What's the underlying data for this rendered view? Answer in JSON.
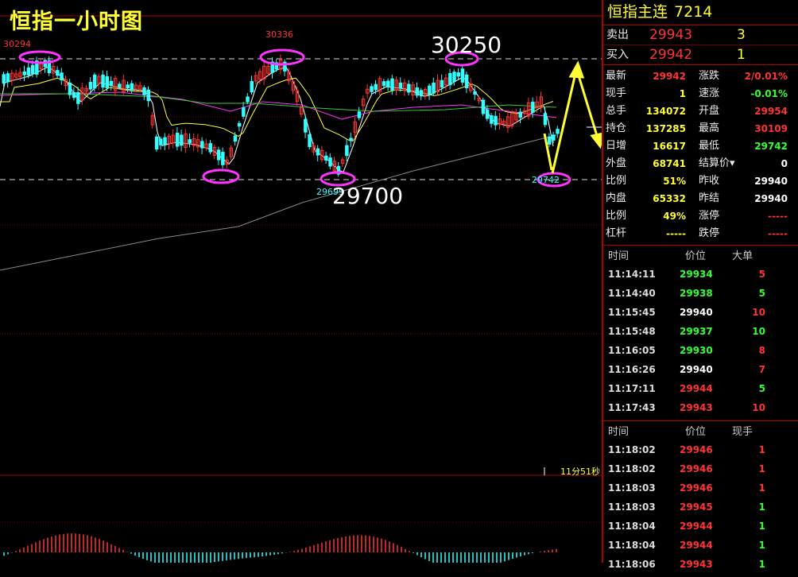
{
  "chart": {
    "title": "恒指一小时图",
    "peak_labels": [
      "30294",
      "30336"
    ],
    "low_labels": [
      "29699",
      "29742"
    ],
    "annotation_high": "30250",
    "annotation_low": "29700",
    "countdown": "11分51秒"
  },
  "quote": {
    "name": "恒指主连",
    "code": "7214",
    "ask_label": "卖出",
    "ask_price": "29943",
    "ask_qty": "3",
    "bid_label": "买入",
    "bid_price": "29942",
    "bid_qty": "1",
    "rows": [
      {
        "k1": "最新",
        "v1": "29942",
        "c1": "red",
        "k2": "涨跌",
        "v2": "2/0.01%",
        "c2": "red"
      },
      {
        "k1": "现手",
        "v1": "1",
        "c1": "yellow",
        "k2": "速涨",
        "v2": "-0.01%",
        "c2": "green"
      },
      {
        "k1": "总手",
        "v1": "134072",
        "c1": "yellow",
        "k2": "开盘",
        "v2": "29954",
        "c2": "red"
      },
      {
        "k1": "持仓",
        "v1": "137285",
        "c1": "yellow",
        "k2": "最高",
        "v2": "30109",
        "c2": "red"
      },
      {
        "k1": "日增",
        "v1": "16617",
        "c1": "yellow",
        "k2": "最低",
        "v2": "29742",
        "c2": "green"
      },
      {
        "k1": "外盘",
        "v1": "68741",
        "c1": "yellow",
        "k2": "结算价▾",
        "v2": "0",
        "c2": "white"
      },
      {
        "k1": "比例",
        "v1": "51%",
        "c1": "yellow",
        "k2": "昨收",
        "v2": "29940",
        "c2": "white"
      },
      {
        "k1": "内盘",
        "v1": "65332",
        "c1": "yellow",
        "k2": "昨结",
        "v2": "29940",
        "c2": "white"
      },
      {
        "k1": "比例",
        "v1": "49%",
        "c1": "yellow",
        "k2": "涨停",
        "v2": "-----",
        "c2": "red"
      },
      {
        "k1": "杠杆",
        "v1": "-----",
        "c1": "yellow",
        "k2": "跌停",
        "v2": "-----",
        "c2": "red"
      }
    ]
  },
  "big_orders": {
    "headers": [
      "时间",
      "价位",
      "大单"
    ],
    "rows": [
      {
        "time": "11:14:11",
        "price": "29934",
        "pc": "green",
        "qty": "5",
        "qc": "red"
      },
      {
        "time": "11:14:40",
        "price": "29938",
        "pc": "green",
        "qty": "5",
        "qc": "green"
      },
      {
        "time": "11:15:45",
        "price": "29940",
        "pc": "white",
        "qty": "10",
        "qc": "red"
      },
      {
        "time": "11:15:48",
        "price": "29937",
        "pc": "green",
        "qty": "10",
        "qc": "green"
      },
      {
        "time": "11:16:05",
        "price": "29930",
        "pc": "green",
        "qty": "8",
        "qc": "red"
      },
      {
        "time": "11:16:26",
        "price": "29940",
        "pc": "white",
        "qty": "7",
        "qc": "red"
      },
      {
        "time": "11:17:11",
        "price": "29944",
        "pc": "red",
        "qty": "5",
        "qc": "green"
      },
      {
        "time": "11:17:43",
        "price": "29943",
        "pc": "red",
        "qty": "10",
        "qc": "red"
      }
    ]
  },
  "ticks": {
    "headers": [
      "时间",
      "价位",
      "现手"
    ],
    "rows": [
      {
        "time": "11:18:02",
        "price": "29946",
        "pc": "red",
        "qty": "1",
        "qc": "red"
      },
      {
        "time": "11:18:02",
        "price": "29946",
        "pc": "red",
        "qty": "1",
        "qc": "red"
      },
      {
        "time": "11:18:03",
        "price": "29946",
        "pc": "red",
        "qty": "1",
        "qc": "red"
      },
      {
        "time": "11:18:03",
        "price": "29945",
        "pc": "red",
        "qty": "1",
        "qc": "green"
      },
      {
        "time": "11:18:04",
        "price": "29944",
        "pc": "red",
        "qty": "1",
        "qc": "green"
      },
      {
        "time": "11:18:04",
        "price": "29944",
        "pc": "red",
        "qty": "1",
        "qc": "green"
      },
      {
        "time": "11:18:06",
        "price": "29943",
        "pc": "red",
        "qty": "1",
        "qc": "green"
      }
    ]
  },
  "colors": {
    "up": "#ff3333",
    "down": "#33ffff",
    "frame": "#aa0000",
    "accent": "#ffff33",
    "marker": "#ff33ff"
  }
}
